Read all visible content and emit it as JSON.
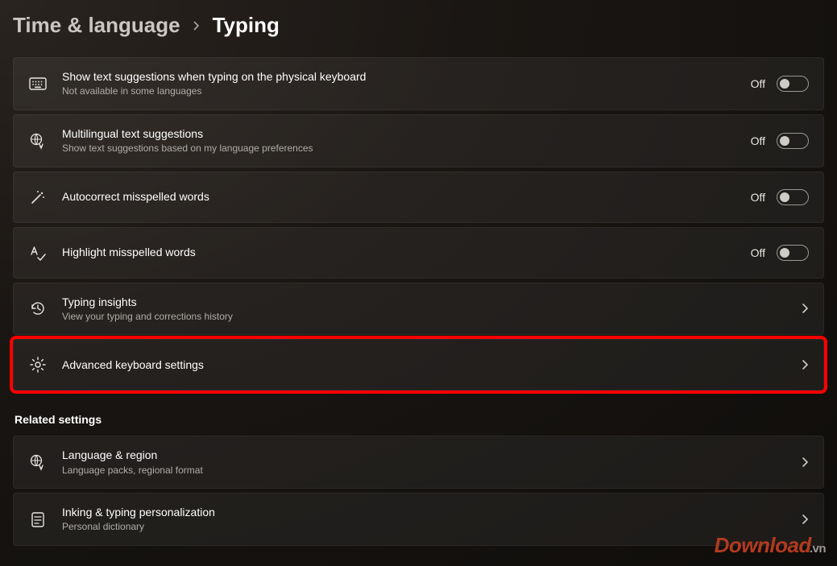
{
  "breadcrumb": {
    "parent": "Time & language",
    "current": "Typing"
  },
  "settings": [
    {
      "id": "text-suggestions",
      "icon": "keyboard",
      "title": "Show text suggestions when typing on the physical keyboard",
      "desc": "Not available in some languages",
      "control": "toggle",
      "state_label": "Off"
    },
    {
      "id": "multilingual",
      "icon": "globe-lang",
      "title": "Multilingual text suggestions",
      "desc": "Show text suggestions based on my language preferences",
      "control": "toggle",
      "state_label": "Off"
    },
    {
      "id": "autocorrect",
      "icon": "wand",
      "title": "Autocorrect misspelled words",
      "desc": "",
      "control": "toggle",
      "state_label": "Off"
    },
    {
      "id": "highlight",
      "icon": "spellcheck",
      "title": "Highlight misspelled words",
      "desc": "",
      "control": "toggle",
      "state_label": "Off"
    },
    {
      "id": "insights",
      "icon": "history",
      "title": "Typing insights",
      "desc": "View your typing and corrections history",
      "control": "nav"
    },
    {
      "id": "advanced",
      "icon": "gear",
      "title": "Advanced keyboard settings",
      "desc": "",
      "control": "nav",
      "highlighted": true
    }
  ],
  "related_heading": "Related settings",
  "related": [
    {
      "id": "language-region",
      "icon": "globe-lang",
      "title": "Language & region",
      "desc": "Language packs, regional format",
      "control": "nav"
    },
    {
      "id": "inking",
      "icon": "notepad",
      "title": "Inking & typing personalization",
      "desc": "Personal dictionary",
      "control": "nav"
    }
  ],
  "watermark": {
    "main": "Download",
    "ext": ".vn"
  }
}
